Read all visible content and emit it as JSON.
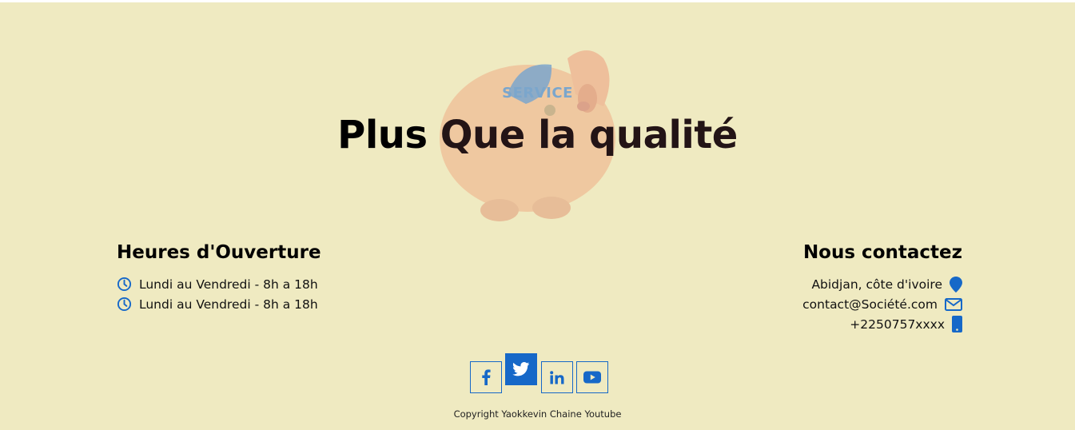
{
  "hero": {
    "tag": "SERVICE",
    "title_part1": "Plus ",
    "title_part2": "Que la qualité"
  },
  "hours": {
    "title": "Heures d'Ouverture",
    "items": [
      "Lundi au Vendredi - 8h a 18h",
      "Lundi au Vendredi - 8h a 18h"
    ]
  },
  "contact": {
    "title": "Nous contactez",
    "address": "Abidjan, côte d'ivoire",
    "email": "contact@Société.com",
    "phone": "+2250757xxxx"
  },
  "socials": [
    "facebook",
    "twitter",
    "linkedin",
    "youtube"
  ],
  "footer": {
    "copyright": "Copyright Yaokkevin Chaine Youtube"
  },
  "colors": {
    "background": "#efeac1",
    "accent": "#1668c8"
  }
}
